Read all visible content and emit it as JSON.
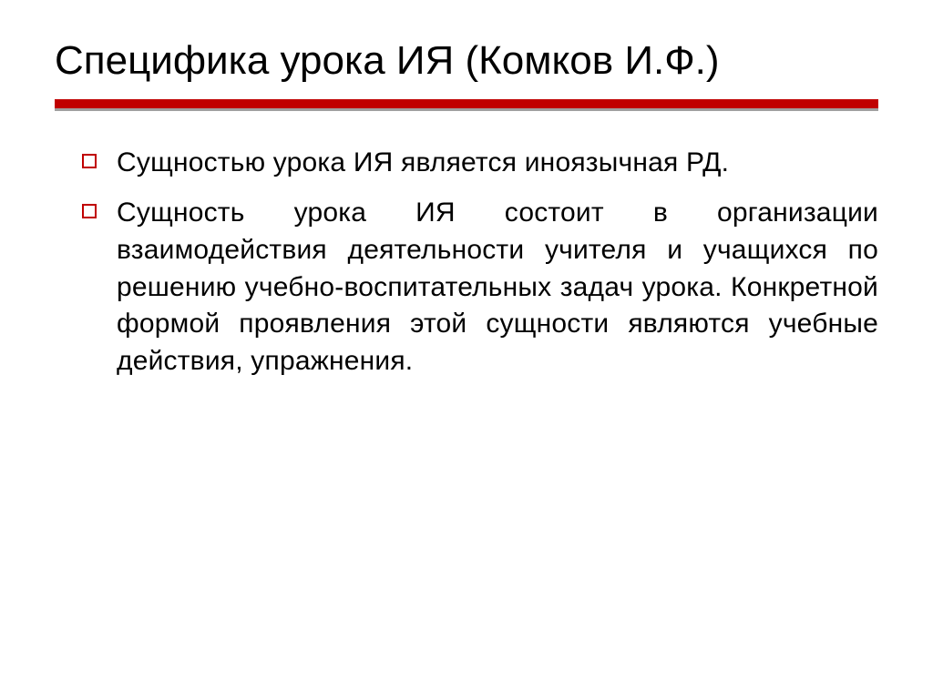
{
  "slide": {
    "title": "Специфика урока ИЯ (Комков И.Ф.)",
    "bullets": [
      "Сущностью урока ИЯ является иноязычная РД.",
      "Сущность урока ИЯ состоит в организации взаимодействия деятельности учителя и учащихся по решению учебно-воспитательных задач урока. Конкретной формой проявления этой сущности являются учебные действия, упражнения."
    ]
  }
}
